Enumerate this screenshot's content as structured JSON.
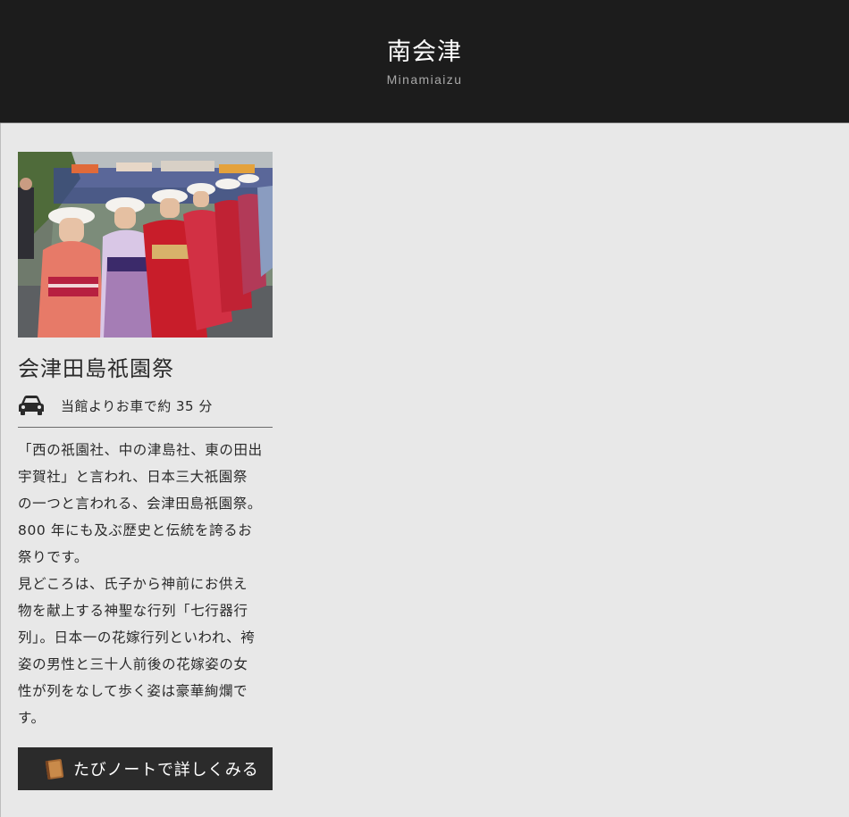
{
  "header": {
    "title": "南会津",
    "subtitle": "Minamiaizu"
  },
  "card": {
    "image_alt": "festival-procession-photo",
    "title": "会津田島祇園祭",
    "access_icon": "car-icon",
    "access_text": "当館よりお車で約 35 分",
    "description": "「西の祇園社、中の津島社、東の田出\n宇賀社」と言われ、日本三大祇園祭\nの一つと言われる、会津田島祇園祭。\n800 年にも及ぶ歴史と伝統を誇るお\n祭りです。\n見どころは、氏子から神前にお供え\n物を献上する神聖な行列「七行器行\n列」。日本一の花嫁行列といわれ、袴\n姿の男性と三十人前後の花嫁姿の女\n性が列をなして歩く姿は豪華絢爛で\nす。",
    "button_icon": "book-icon",
    "button_label": "たびノートで詳しくみる"
  },
  "colors": {
    "header_bg": "#1c1c1c",
    "page_bg": "#e8e8e8",
    "button_bg": "#2b2b2b"
  }
}
